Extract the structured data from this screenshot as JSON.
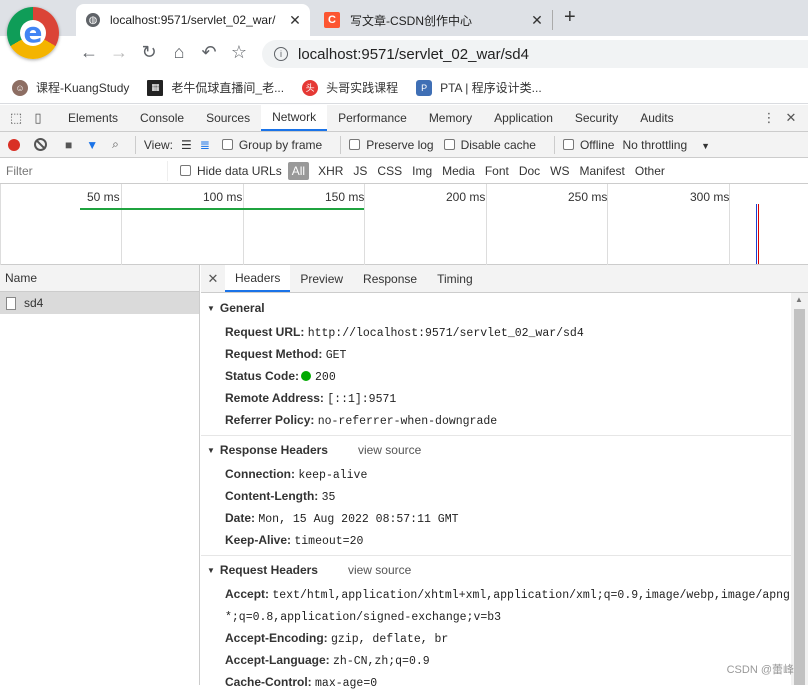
{
  "browser": {
    "tabs": [
      {
        "title": "localhost:9571/servlet_02_war/",
        "active": true
      },
      {
        "title": "写文章-CSDN创作中心",
        "active": false
      }
    ],
    "new_tab_glyph": "+",
    "url": "localhost:9571/servlet_02_war/sd4",
    "bookmarks": [
      {
        "label": "课程-KuangStudy",
        "icon": "avatar-icon"
      },
      {
        "label": "老牛侃球直播间_老...",
        "icon": "qr-icon"
      },
      {
        "label": "头哥实践课程",
        "icon": "toutiao-icon"
      },
      {
        "label": "PTA | 程序设计类...",
        "icon": "pta-icon"
      }
    ]
  },
  "devtools": {
    "tabs": [
      "Elements",
      "Console",
      "Sources",
      "Network",
      "Performance",
      "Memory",
      "Application",
      "Security",
      "Audits"
    ],
    "active_tab": "Network",
    "network_toolbar": {
      "view_label": "View:",
      "group_by_frame": "Group by frame",
      "preserve_log": "Preserve log",
      "disable_cache": "Disable cache",
      "offline": "Offline",
      "throttling": "No throttling"
    },
    "filter": {
      "placeholder": "Filter",
      "hide_data_urls": "Hide data URLs",
      "types": [
        "All",
        "XHR",
        "JS",
        "CSS",
        "Img",
        "Media",
        "Font",
        "Doc",
        "WS",
        "Manifest",
        "Other"
      ]
    },
    "timeline": {
      "ticks": [
        "50 ms",
        "100 ms",
        "150 ms",
        "200 ms",
        "250 ms",
        "300 ms"
      ]
    },
    "requests": {
      "column_header": "Name",
      "items": [
        "sd4"
      ]
    },
    "detail_tabs": [
      "Headers",
      "Preview",
      "Response",
      "Timing"
    ],
    "general": {
      "title": "General",
      "request_url": {
        "key": "Request URL:",
        "value": "http://localhost:9571/servlet_02_war/sd4"
      },
      "request_method": {
        "key": "Request Method:",
        "value": "GET"
      },
      "status_code": {
        "key": "Status Code:",
        "value": "200"
      },
      "remote_address": {
        "key": "Remote Address:",
        "value": "[::1]:9571"
      },
      "referrer_policy": {
        "key": "Referrer Policy:",
        "value": "no-referrer-when-downgrade"
      }
    },
    "response_headers": {
      "title": "Response Headers",
      "view_source": "view source",
      "items": [
        {
          "key": "Connection:",
          "value": "keep-alive"
        },
        {
          "key": "Content-Length:",
          "value": "35"
        },
        {
          "key": "Date:",
          "value": "Mon, 15 Aug 2022 08:57:11 GMT"
        },
        {
          "key": "Keep-Alive:",
          "value": "timeout=20"
        }
      ]
    },
    "request_headers": {
      "title": "Request Headers",
      "view_source": "view source",
      "accept": {
        "key": "Accept:",
        "value": "text/html,application/xhtml+xml,application/xml;q=0.9,image/webp,image/apng,*/",
        "value_cont": "*;q=0.8,application/signed-exchange;v=b3"
      },
      "items": [
        {
          "key": "Accept-Encoding:",
          "value": "gzip, deflate, br"
        },
        {
          "key": "Accept-Language:",
          "value": "zh-CN,zh;q=0.9"
        },
        {
          "key": "Cache-Control:",
          "value": "max-age=0"
        }
      ]
    }
  },
  "watermark": "CSDN @蕾峰"
}
